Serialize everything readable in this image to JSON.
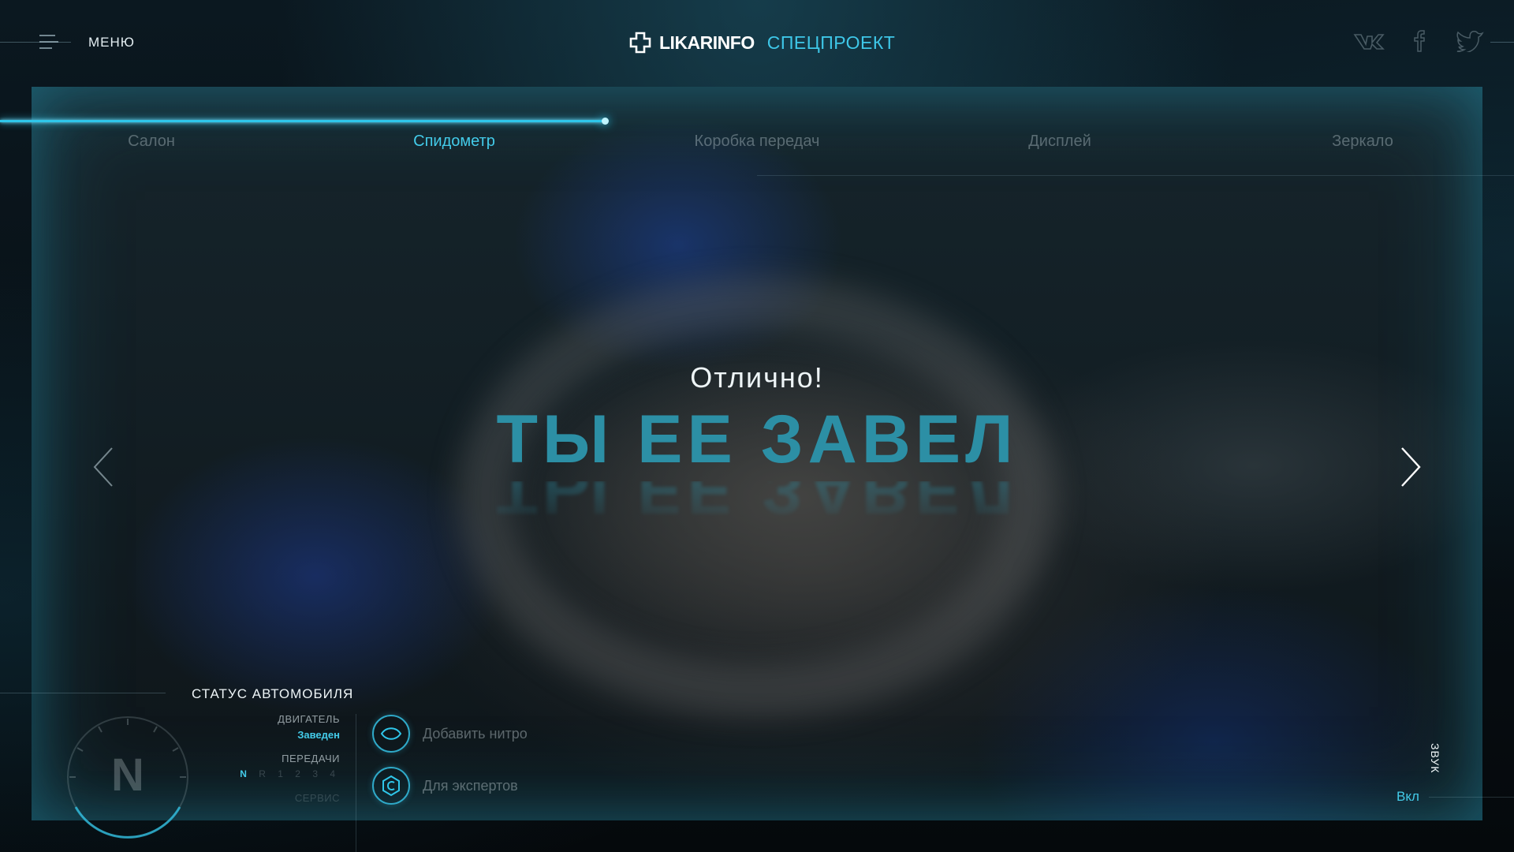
{
  "header": {
    "menu_label": "МЕНЮ",
    "brand_name": "LIKARINFO",
    "brand_sub": "СПЕЦПРОЕКТ",
    "social": [
      "vk-icon",
      "facebook-icon",
      "twitter-icon"
    ]
  },
  "progress": {
    "value": 0.4
  },
  "tabs": [
    {
      "label": "Салон",
      "active": false
    },
    {
      "label": "Спидометр",
      "active": true
    },
    {
      "label": "Коробка передач",
      "active": false
    },
    {
      "label": "Дисплей",
      "active": false
    },
    {
      "label": "Зеркало",
      "active": false
    }
  ],
  "hero": {
    "kicker": "Отлично!",
    "headline": "ТЫ ЕЕ ЗАВЕЛ"
  },
  "status": {
    "title": "СТАТУС АВТОМОБИЛЯ",
    "engine_label": "ДВИГАТЕЛЬ",
    "engine_value": "Заведен",
    "gears_label": "ПЕРЕДАЧИ",
    "gear_current": "N",
    "gears_other": "R 1 2 3 4",
    "service_label": "СЕРВИС",
    "gauge_letter": "N"
  },
  "actions": [
    {
      "label": "Добавить нитро",
      "icon": "nitro-icon"
    },
    {
      "label": "Для экспертов",
      "icon": "expert-icon"
    }
  ],
  "sound": {
    "label": "ЗВУК",
    "value": "Вкл"
  },
  "colors": {
    "accent": "#43cbe9",
    "headline": "#2c8fa5"
  }
}
